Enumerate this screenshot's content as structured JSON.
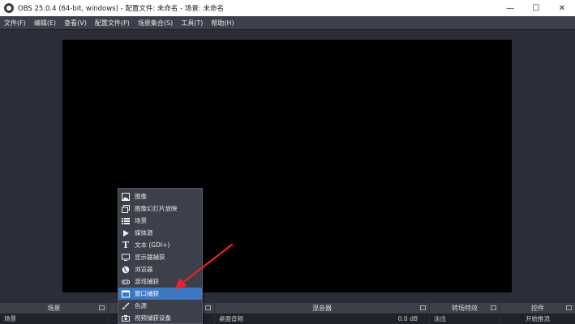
{
  "window": {
    "title": "OBS 25.0.4 (64-bit, windows) - 配置文件: 未命名 - 场景: 未命名",
    "minimize": "—",
    "maximize": "☐",
    "close": "✕"
  },
  "menu": {
    "items": [
      "文件(F)",
      "编辑(E)",
      "查看(V)",
      "配置文件(P)",
      "场景集合(S)",
      "工具(T)",
      "帮助(H)"
    ]
  },
  "docks": {
    "scenes": {
      "title": "场景",
      "item": "场景"
    },
    "sources": {
      "title": "",
      "item": ""
    },
    "mixer": {
      "title": "混音器",
      "track": "桌面音频",
      "level": "0.0 dB"
    },
    "transitions": {
      "title": "转场特效",
      "item": "淡出"
    },
    "controls": {
      "title": "控件",
      "button": "开始推流"
    }
  },
  "context_menu": {
    "items": [
      {
        "label": "图像",
        "icon": "image-icon"
      },
      {
        "label": "图像幻灯片放映",
        "icon": "slideshow-icon"
      },
      {
        "label": "场景",
        "icon": "scene-list-icon"
      },
      {
        "label": "媒体源",
        "icon": "play-icon"
      },
      {
        "label": "文本 (GDI+)",
        "icon": "text-icon"
      },
      {
        "label": "显示器捕获",
        "icon": "monitor-icon"
      },
      {
        "label": "浏览器",
        "icon": "globe-icon"
      },
      {
        "label": "游戏捕获",
        "icon": "gamepad-icon"
      },
      {
        "label": "窗口捕获",
        "icon": "window-icon",
        "selected": true
      },
      {
        "label": "色源",
        "icon": "brush-icon"
      },
      {
        "label": "视频捕获设备",
        "icon": "camera-icon"
      }
    ]
  },
  "colors": {
    "background": "#2b2e38",
    "panel": "#3c404b",
    "selection": "#3f78c2",
    "annotation_arrow": "#e8242c"
  }
}
